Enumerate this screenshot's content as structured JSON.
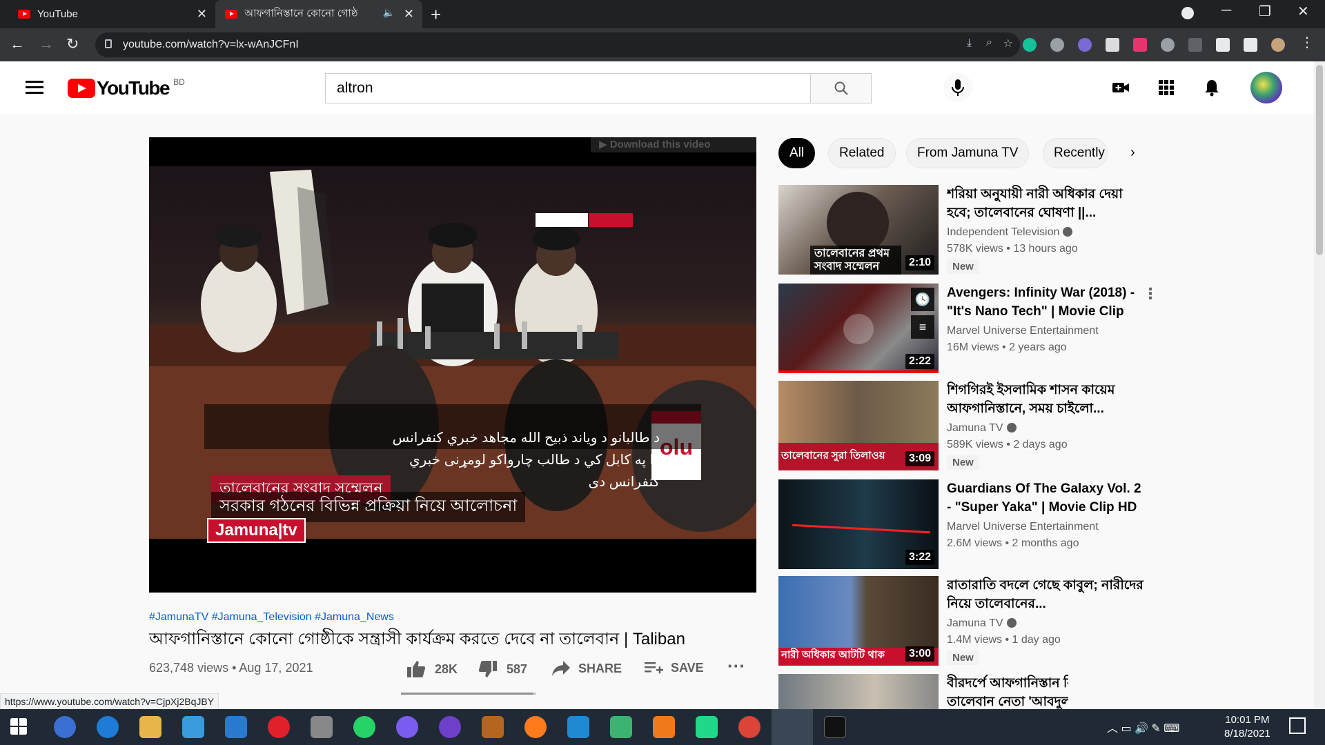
{
  "browser": {
    "tabs": [
      {
        "label": "YouTube",
        "active": false
      },
      {
        "label": "আফগানিস্তানে কোনো গোষ্ঠ",
        "active": true
      }
    ],
    "url": "youtube.com/watch?v=lx-wAnJCFnI",
    "status_url": "https://www.youtube.com/watch?v=CjpXj2BqJBY"
  },
  "header": {
    "logo_text": "YouTube",
    "country_code": "BD",
    "search_value": "altron"
  },
  "video": {
    "download_overlay": "Download this video",
    "caption_pashto_1": "د طالبانو د وياند ذبيح الله مجاهد خبري كنفرانس",
    "caption_pashto_2": "دا په كابل كي د طالب چارواكو لومړنى خبري كنفرانس دى",
    "lower_third_1": "তালেবানের সংবাদ সম্মেলন",
    "lower_third_2": "সরকার গঠনের বিভিন্ন প্রক্রিয়া নিয়ে আলোচনা",
    "channel_bug": "Jamuna|tv",
    "hashtags": "#JamunaTV #Jamuna_Television #Jamuna_News",
    "title": "আফগানিস্তানে কোনো গোষ্ঠীকে সন্ত্রাসী কার্যক্রম করতে দেবে না তালেবান | Taliban",
    "views_date": "623,748 views • Aug 17, 2021",
    "likes": "28K",
    "dislikes": "587",
    "share_label": "SHARE",
    "save_label": "SAVE",
    "like_ratio": 0.979
  },
  "chips": [
    "All",
    "Related",
    "From Jamuna TV",
    "Recently"
  ],
  "recommendations": [
    {
      "title": "শরিয়া অনুযায়ী নারী অধিকার দেয়া হবে; তালেবানের ঘোষণা ||...",
      "channel": "Independent Television",
      "verified": true,
      "meta": "578K views • 13 hours ago",
      "badge": "New",
      "duration": "2:10"
    },
    {
      "title": "Avengers: Infinity War (2018) - \"It's Nano Tech\" | Movie Clip",
      "channel": "Marvel Universe Entertainment",
      "verified": false,
      "meta": "16M views • 2 years ago",
      "badge": "",
      "duration": "2:22"
    },
    {
      "title": "শিগগিরই ইসলামিক শাসন কায়েম আফগানিস্তানে, সময় চাইলো...",
      "channel": "Jamuna TV",
      "verified": true,
      "meta": "589K views • 2 days ago",
      "badge": "New",
      "duration": "3:09"
    },
    {
      "title": "Guardians Of The Galaxy Vol. 2 - \"Super Yaka\" | Movie Clip HD",
      "channel": "Marvel Universe Entertainment",
      "verified": false,
      "meta": "2.6M views • 2 months ago",
      "badge": "",
      "duration": "3:22"
    },
    {
      "title": "রাতারাতি বদলে গেছে কাবুল; নারীদের নিয়ে তালেবানের...",
      "channel": "Jamuna TV",
      "verified": true,
      "meta": "1.4M views • 1 day ago",
      "badge": "New",
      "duration": "3:00"
    },
    {
      "title": "বীরদর্পে আফগানিস্তান ফিরলেন তালেবান নেতা 'আবদুল গণি...",
      "channel": "",
      "verified": false,
      "meta": "",
      "badge": "",
      "duration": ""
    }
  ],
  "thumb_captions": {
    "t0": "তালেবানের প্রথম সংবাদ সম্মেলন",
    "t2": "তালেবানের সুরা তিলাওয়",
    "t4": "নারী অধিকার আটটি থাক"
  },
  "taskbar": {
    "time": "10:01 PM",
    "date": "8/18/2021"
  }
}
